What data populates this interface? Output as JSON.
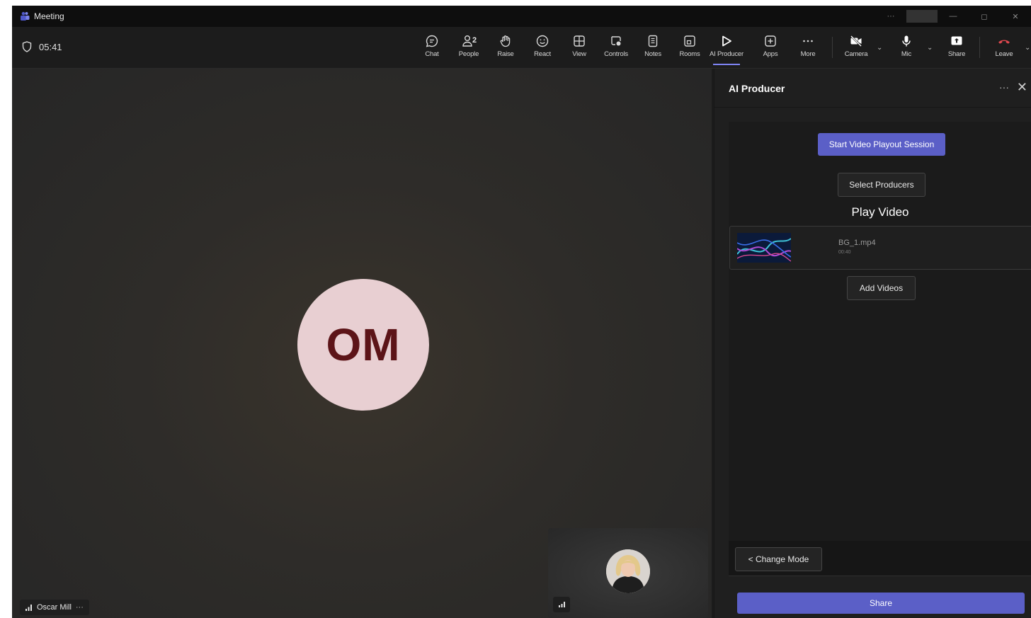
{
  "window": {
    "title": "Meeting",
    "controls": {
      "more": "···",
      "minimize": "—",
      "restore": "◻",
      "close": "✕"
    }
  },
  "toolbar": {
    "timer": "05:41",
    "people_count": "2",
    "items": {
      "chat": "Chat",
      "people": "People",
      "raise": "Raise",
      "react": "React",
      "view": "View",
      "controls": "Controls",
      "notes": "Notes",
      "rooms": "Rooms",
      "ai_producer": "AI Producer",
      "apps": "Apps",
      "more": "More",
      "camera": "Camera",
      "mic": "Mic",
      "share": "Share",
      "leave": "Leave"
    },
    "colors": {
      "leave": "#e0484f",
      "active_underline": "#7f85f5"
    }
  },
  "stage": {
    "participant_initials": "OM",
    "participant_name": "Oscar Mill",
    "name_more": "···"
  },
  "panel": {
    "title": "AI Producer",
    "start_session_label": "Start Video Playout Session",
    "select_producers_label": "Select Producers",
    "play_video_heading": "Play Video",
    "video": {
      "name": "BG_1.mp4",
      "duration": "00:40"
    },
    "add_videos_label": "Add Videos",
    "change_mode_label": "< Change Mode",
    "share_label": "Share",
    "colors": {
      "primary": "#5b5fc7"
    }
  }
}
